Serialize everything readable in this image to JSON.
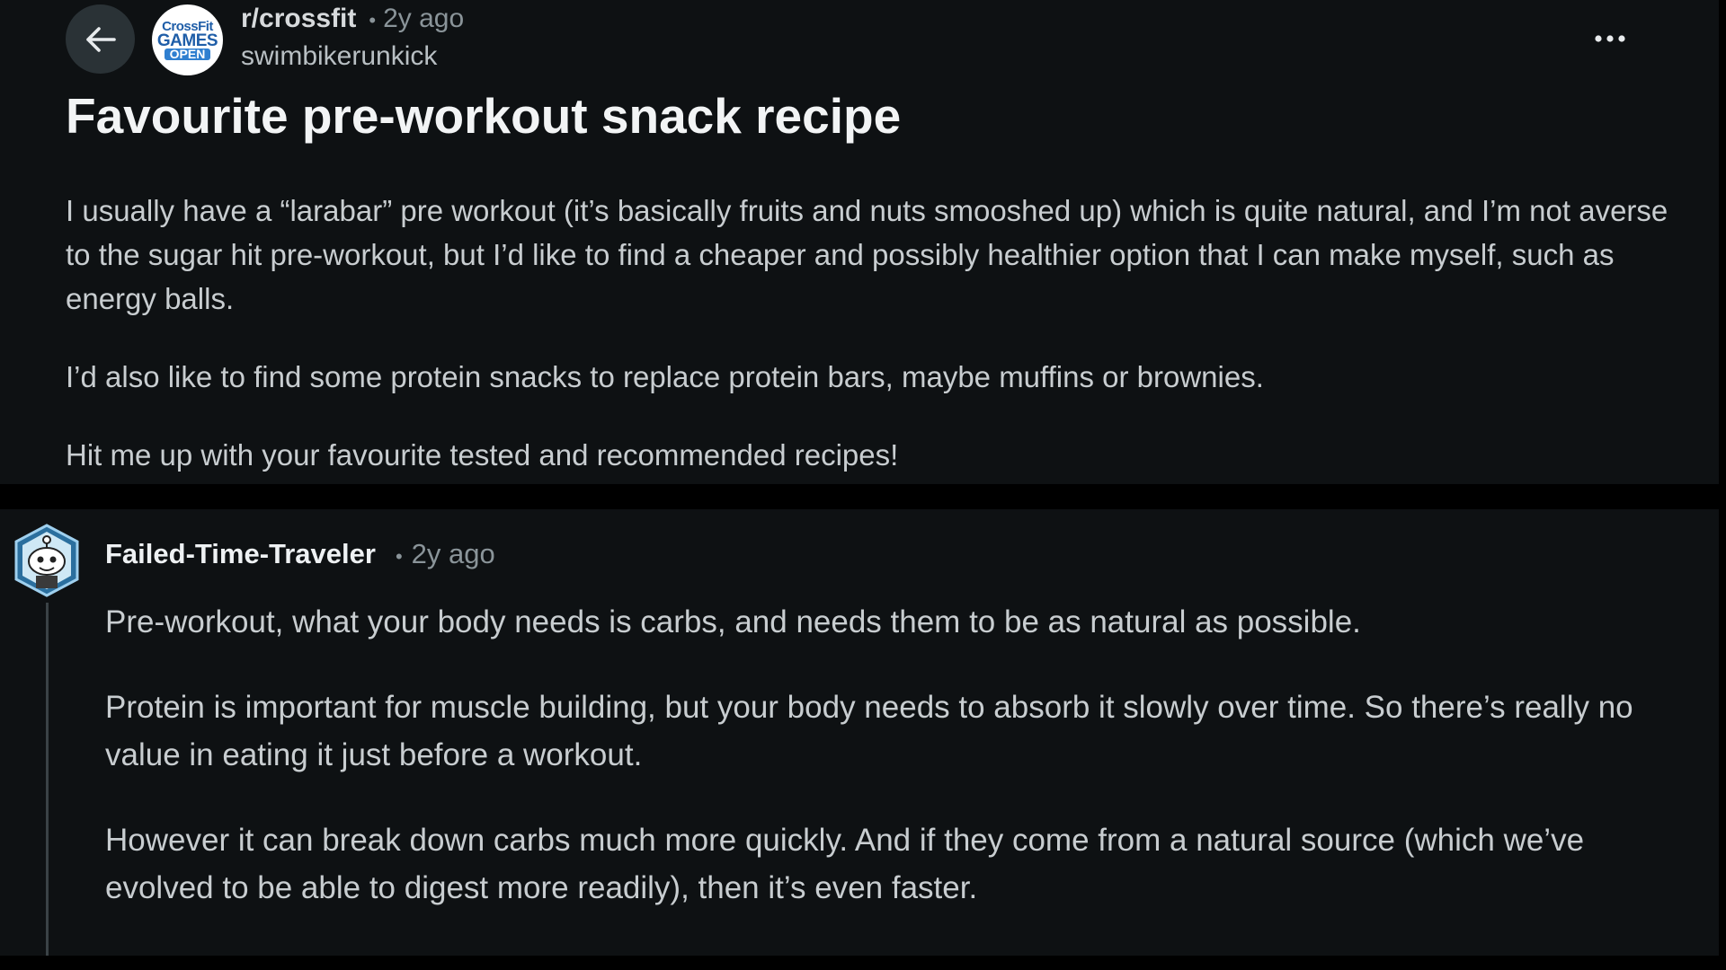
{
  "post": {
    "subreddit": "r/crossfit",
    "separator": "•",
    "time_ago": "2y ago",
    "author": "swimbikerunkick",
    "title": "Favourite pre-workout snack recipe",
    "paragraphs": [
      "I usually have a “larabar” pre workout (it’s basically fruits and nuts smooshed up) which is quite natural, and I’m not averse to the sugar hit pre-workout, but I’d like to find a cheaper and possibly healthier option that I can make myself, such as energy balls.",
      "I’d also like to find some protein snacks to replace protein bars, maybe muffins or brownies.",
      "Hit me up with your favourite tested and recommended recipes!"
    ],
    "avatar": {
      "line1": "CrossFit",
      "line2": "GAMES",
      "line3": "OPEN"
    }
  },
  "comment": {
    "author": "Failed-Time-Traveler",
    "separator": "•",
    "time_ago": "2y ago",
    "paragraphs": [
      "Pre-workout, what your body needs is carbs, and needs them to be as natural as possible.",
      "Protein is important for muscle building, but your body needs to absorb it slowly over time. So there’s really no value in eating it just before a workout.",
      "However it can break down carbs much more quickly. And if they come from a natural source (which we’ve evolved to be able to digest more readily), then it’s even faster."
    ]
  },
  "icons": {
    "back": "arrow-left-icon",
    "more": "more-horizontal-icon",
    "subreddit_avatar": "crossfit-games-open-logo",
    "user_avatar": "user-snoo-avatar-icon"
  },
  "colors": {
    "page_background": "#000000",
    "card_background": "#0e1113",
    "title_text": "#f2f4f5",
    "body_text": "#c8cdd0",
    "muted_text": "#8a9499",
    "back_button_background": "#2a3236",
    "brand_blue": "#1f5ea8"
  }
}
